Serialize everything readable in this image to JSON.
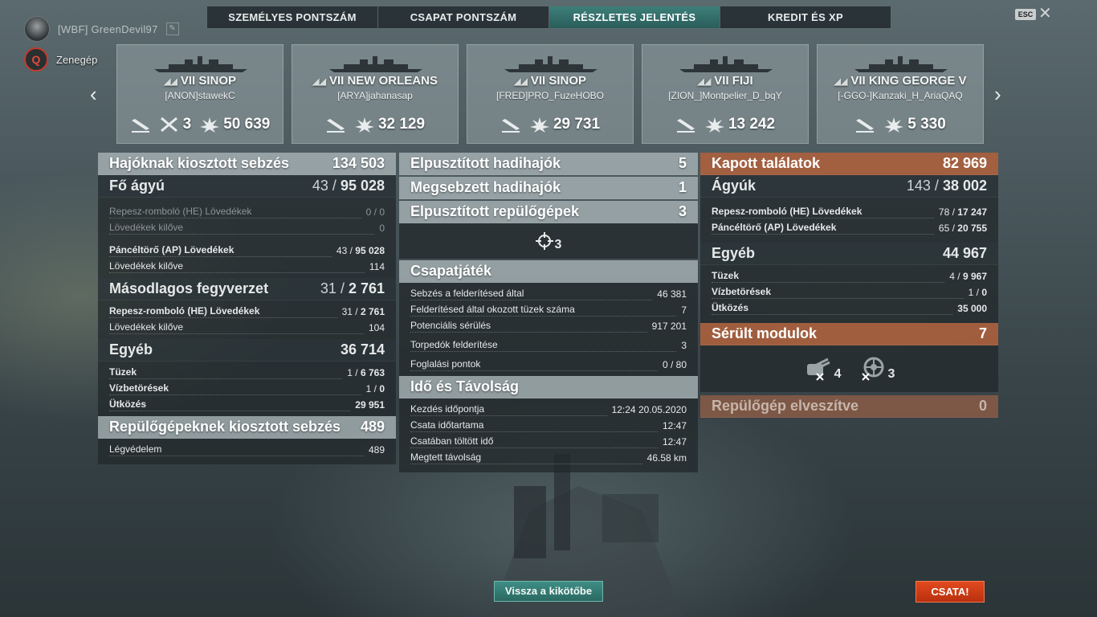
{
  "player": {
    "name": "[WBF] GreenDevil97",
    "mode": "Zenegép"
  },
  "tabs": [
    {
      "label": "SZEMÉLYES PONTSZÁM",
      "active": false
    },
    {
      "label": "CSAPAT PONTSZÁM",
      "active": false
    },
    {
      "label": "RÉSZLETES JELENTÉS",
      "active": true
    },
    {
      "label": "KREDIT ÉS XP",
      "active": false
    }
  ],
  "esc_label": "ESC",
  "close_glyph": "✕",
  "arrows": {
    "left": "‹",
    "right": "›"
  },
  "cards": [
    {
      "tier": "VII",
      "ship": "SINOP",
      "player": "[ANON]stawekC",
      "kills": "3",
      "damage": "50 639"
    },
    {
      "tier": "VII",
      "ship": "NEW ORLEANS",
      "player": "[ARYA]jahanasap",
      "damage": "32 129"
    },
    {
      "tier": "VII",
      "ship": "SINOP",
      "player": "[FRED]PRO_FuzeHOBO",
      "damage": "29 731"
    },
    {
      "tier": "VII",
      "ship": "FIJI",
      "player": "[ZION_]Montpelier_D_bqY",
      "damage": "13 242"
    },
    {
      "tier": "VII",
      "ship": "KING GEORGE V",
      "player": "[-GGO-]Kanzaki_H_AriaQAQ",
      "damage": "5 330"
    }
  ],
  "col1": {
    "ship_damage": {
      "label": "Hajóknak kiosztott sebzés",
      "value": "134 503"
    },
    "main_guns": {
      "label": "Fő ágyú",
      "hits": "43",
      "value": "95 028"
    },
    "he_label": "Repesz-romboló (HE) Lövedékek",
    "he_value": "0 / 0",
    "he_fired_label": "Lövedékek kilőve",
    "he_fired": "0",
    "ap_label": "Páncéltörő (AP) Lövedékek",
    "ap_hits": "43",
    "ap_value": "95 028",
    "ap_fired_label": "Lövedékek kilőve",
    "ap_fired": "114",
    "secondary": {
      "label": "Másodlagos fegyverzet",
      "hits": "31",
      "value": "2 761"
    },
    "sec_he_label": "Repesz-romboló (HE) Lövedékek",
    "sec_he_hits": "31",
    "sec_he_value": "2 761",
    "sec_fired_label": "Lövedékek kilőve",
    "sec_fired": "104",
    "other": {
      "label": "Egyéb",
      "value": "36 714"
    },
    "fires_label": "Tüzek",
    "fires_hits": "1",
    "fires_value": "6 763",
    "flood_label": "Vízbetörések",
    "flood_hits": "1",
    "flood_value": "0",
    "ram_label": "Ütközés",
    "ram_value": "29 951",
    "plane_damage": {
      "label": "Repülőgépeknek kiosztott sebzés",
      "value": "489"
    },
    "aa_label": "Légvédelem",
    "aa_value": "489"
  },
  "col2": {
    "destroyed_ships": {
      "label": "Elpusztított hadihajók",
      "value": "5"
    },
    "damaged_ships": {
      "label": "Megsebzett hadihajók",
      "value": "1"
    },
    "destroyed_planes": {
      "label": "Elpusztított repülőgépek",
      "value": "3"
    },
    "planes_count": "3",
    "team": {
      "label": "Csapatjáték"
    },
    "team_rows": [
      {
        "label": "Sebzés a felderítésed által",
        "value": "46 381"
      },
      {
        "label": "Felderítésed által okozott tüzek száma",
        "value": "7"
      },
      {
        "label": "Potenciális sérülés",
        "value": "917 201"
      },
      {
        "label": "Torpedók felderítése",
        "value": "3"
      },
      {
        "label": "Foglalási pontok",
        "value": "0 / 80"
      }
    ],
    "time": {
      "label": "Idő és Távolság"
    },
    "time_rows": [
      {
        "label": "Kezdés időpontja",
        "value": "12:24  20.05.2020"
      },
      {
        "label": "Csata időtartama",
        "value": "12:47"
      },
      {
        "label": "Csatában töltött idő",
        "value": "12:47"
      },
      {
        "label": "Megtett távolság",
        "value": "46.58 km"
      }
    ]
  },
  "col3": {
    "received": {
      "label": "Kapott találatok",
      "value": "82 969"
    },
    "guns": {
      "label": "Ágyúk",
      "hits": "143",
      "value": "38 002"
    },
    "he_label": "Repesz-romboló (HE) Lövedékek",
    "he_hits": "78",
    "he_value": "17 247",
    "ap_label": "Páncéltörő (AP) Lövedékek",
    "ap_hits": "65",
    "ap_value": "20 755",
    "other": {
      "label": "Egyéb",
      "value": "44 967"
    },
    "fires_label": "Tüzek",
    "fires_hits": "4",
    "fires_value": "9 967",
    "flood_label": "Vízbetörések",
    "flood_hits": "1",
    "flood_value": "0",
    "ram_label": "Ütközés",
    "ram_value": "35 000",
    "modules": {
      "label": "Sérült modulok",
      "value": "7"
    },
    "module_items": [
      {
        "icon": "turret-icon",
        "count": "4"
      },
      {
        "icon": "steering-gear-icon",
        "count": "3"
      }
    ],
    "planes_lost": {
      "label": "Repülőgép elveszítve",
      "value": "0"
    }
  },
  "buttons": {
    "port": "Vissza a kikötőbe",
    "battle": "CSATA!"
  },
  "colors": {
    "accent_teal": "#3f8e86",
    "battle_red": "#d63d16",
    "received_orange": "#b2623c"
  }
}
